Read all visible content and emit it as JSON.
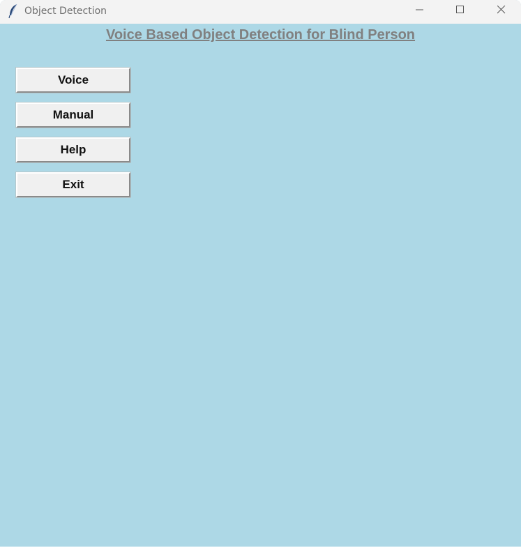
{
  "window": {
    "title": "Object Detection",
    "icon": "feather-icon",
    "controls": [
      "minimize-icon",
      "maximize-icon",
      "close-icon"
    ]
  },
  "main": {
    "heading": "Voice Based Object Detection for Blind Person",
    "buttons": [
      {
        "label": "Voice"
      },
      {
        "label": "Manual"
      },
      {
        "label": "Help"
      },
      {
        "label": "Exit"
      }
    ]
  },
  "colors": {
    "background": "#add8e6",
    "titlebar": "#f3f3f3",
    "heading": "#808080",
    "button_face": "#f0f0f0"
  }
}
